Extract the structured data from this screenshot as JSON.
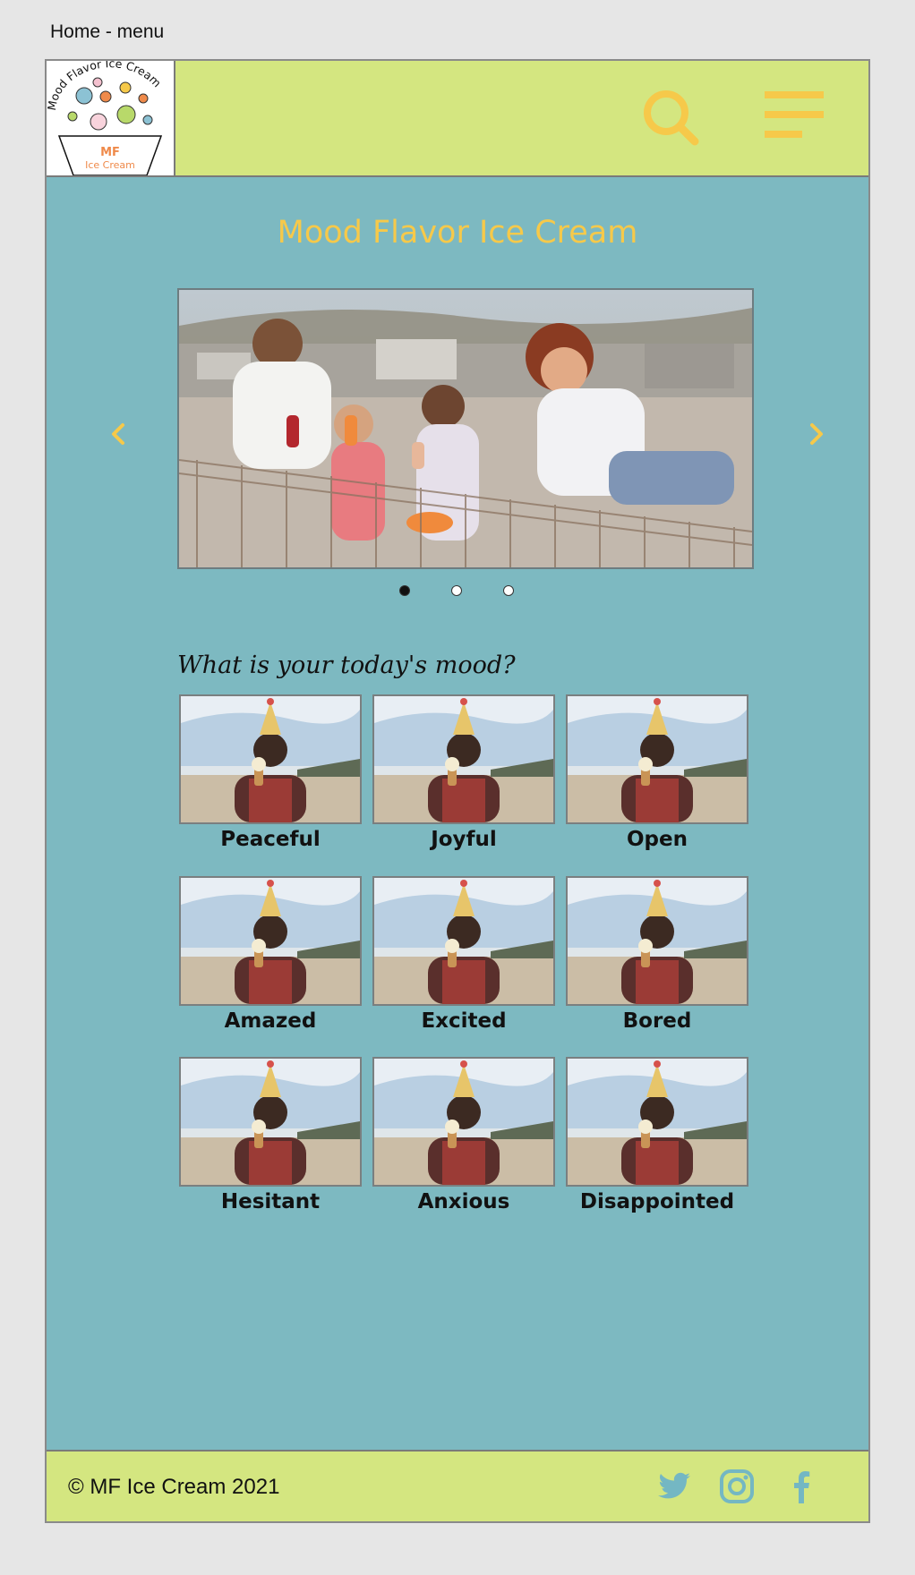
{
  "frame_label": "Home - menu",
  "header": {
    "logo": {
      "ring_text": "Mood Flavor Ice Cream",
      "initials": "MF",
      "subtitle": "Ice Cream"
    },
    "search_icon": "search-icon",
    "menu_icon": "hamburger-menu-icon"
  },
  "title": "Mood Flavor Ice Cream",
  "carousel": {
    "slide_count": 3,
    "active_index": 0,
    "prev_icon": "chevron-left-icon",
    "next_icon": "chevron-right-icon"
  },
  "mood_heading": "What is your today's mood?",
  "moods": [
    {
      "label": "Peaceful"
    },
    {
      "label": "Joyful"
    },
    {
      "label": "Open"
    },
    {
      "label": "Amazed"
    },
    {
      "label": "Excited"
    },
    {
      "label": "Bored"
    },
    {
      "label": "Hesitant"
    },
    {
      "label": "Anxious"
    },
    {
      "label": "Disappointed"
    }
  ],
  "footer": {
    "copyright": "© MF Ice Cream 2021",
    "social": [
      "twitter-icon",
      "instagram-icon",
      "facebook-icon"
    ]
  },
  "colors": {
    "header_bg": "#d4e680",
    "page_bg": "#7db9c1",
    "accent": "#f6c94a",
    "social": "#74b7c3"
  }
}
